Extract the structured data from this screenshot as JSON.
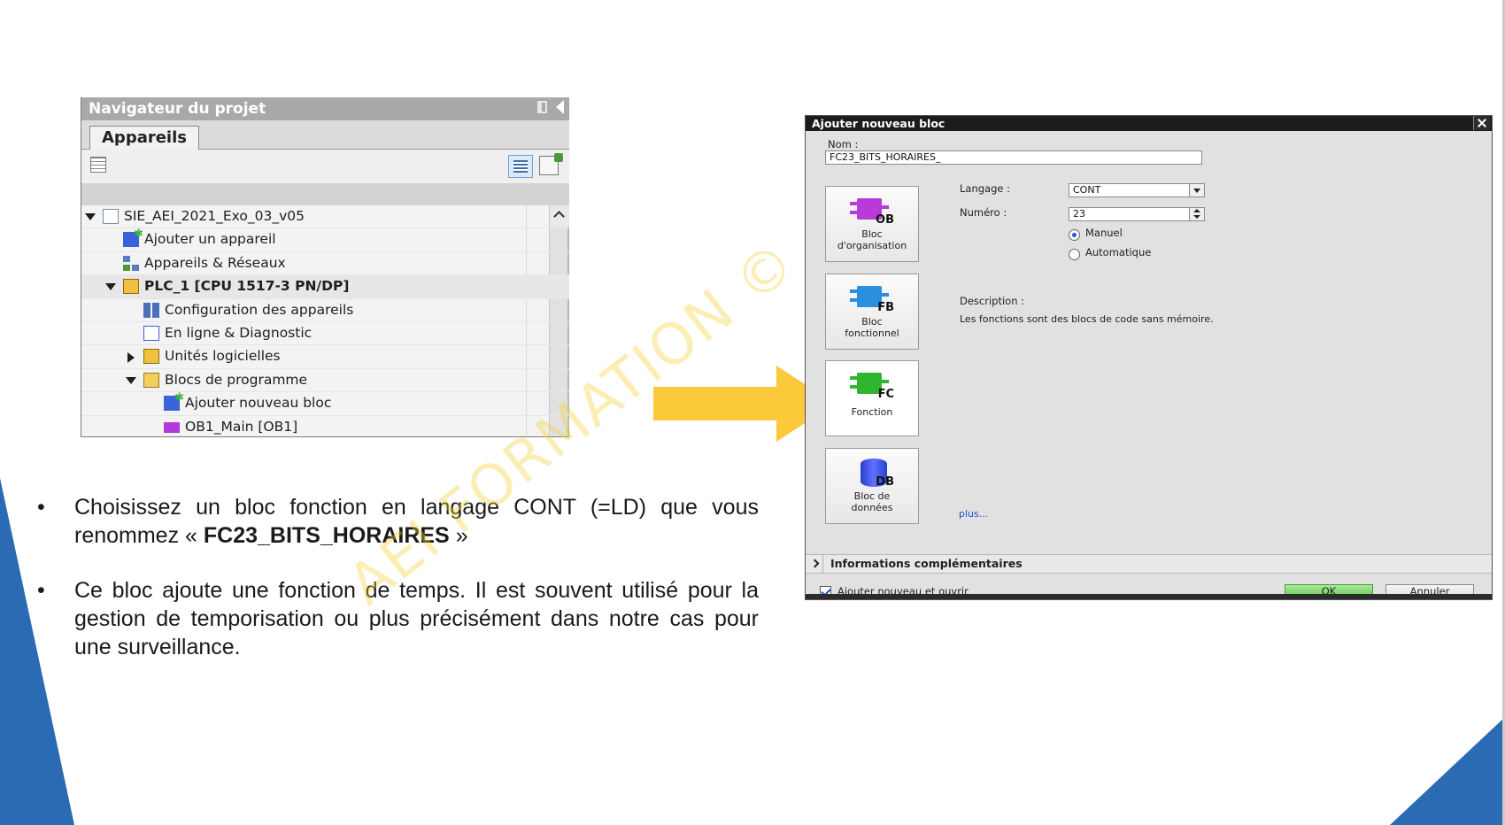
{
  "navigator": {
    "title": "Navigateur du projet",
    "tab": "Appareils",
    "tree": [
      {
        "label": "SIE_AEI_2021_Exo_03_v05",
        "level": 0,
        "twisty": "down",
        "icon": "project-icon"
      },
      {
        "label": "Ajouter un appareil",
        "level": 1,
        "twisty": "",
        "icon": "add-device-icon"
      },
      {
        "label": "Appareils & Réseaux",
        "level": 1,
        "twisty": "",
        "icon": "network-icon"
      },
      {
        "label": "PLC_1 [CPU 1517-3 PN/DP]",
        "level": 1,
        "twisty": "down",
        "icon": "plc-icon",
        "selected": true
      },
      {
        "label": "Configuration des appareils",
        "level": 2,
        "twisty": "",
        "icon": "device-config-icon"
      },
      {
        "label": "En ligne & Diagnostic",
        "level": 2,
        "twisty": "",
        "icon": "online-diagnostic-icon"
      },
      {
        "label": "Unités logicielles",
        "level": 2,
        "twisty": "right",
        "icon": "software-units-icon"
      },
      {
        "label": "Blocs de programme",
        "level": 2,
        "twisty": "down",
        "icon": "folder-icon"
      },
      {
        "label": "Ajouter nouveau bloc",
        "level": 3,
        "twisty": "",
        "icon": "add-block-icon"
      },
      {
        "label": "OB1_Main [OB1]",
        "level": 3,
        "twisty": "",
        "icon": "ob-block-icon"
      }
    ]
  },
  "bullets": {
    "b1_pre": "Choisissez un bloc fonction en langage CONT (=LD) que vous renommez « ",
    "b1_bold": "FC23_BITS_HORAIRES",
    "b1_post": " »",
    "b2": "Ce bloc ajoute une fonction de temps. Il est souvent utilisé pour la gestion de temporisation ou plus précisément dans notre cas pour une surveillance.",
    "bullet_char": "•"
  },
  "watermark": "AEI FORMATION ©",
  "dialog": {
    "title": "Ajouter nouveau bloc",
    "name_label": "Nom :",
    "name_value": "FC23_BITS_HORAIRES_",
    "language_label": "Langage :",
    "language_value": "CONT",
    "number_label": "Numéro :",
    "number_value": "23",
    "radio_manual": "Manuel",
    "radio_auto": "Automatique",
    "description_label": "Description :",
    "description_text": "Les fonctions sont des blocs de code sans mémoire.",
    "more_link": "plus...",
    "blocks": [
      {
        "tag": "OB",
        "line1": "Bloc",
        "line2": "d'organisation",
        "color": "#b83ad8"
      },
      {
        "tag": "FB",
        "line1": "Bloc",
        "line2": "fonctionnel",
        "color": "#2b8fe0"
      },
      {
        "tag": "FC",
        "line1": "Fonction",
        "line2": "",
        "color": "#2fb52f"
      },
      {
        "tag": "DB",
        "line1": "Bloc de",
        "line2": "données",
        "color": "#3b4fe0"
      }
    ],
    "info_bar": "Informations complémentaires",
    "add_open_label": "Ajouter nouveau et ouvrir",
    "ok_label": "OK",
    "cancel_label": "Annuler"
  },
  "colors": {
    "arrow": "#fcc93a",
    "deco_blue": "#2a6bb4",
    "watermark": "#f5d23c"
  }
}
